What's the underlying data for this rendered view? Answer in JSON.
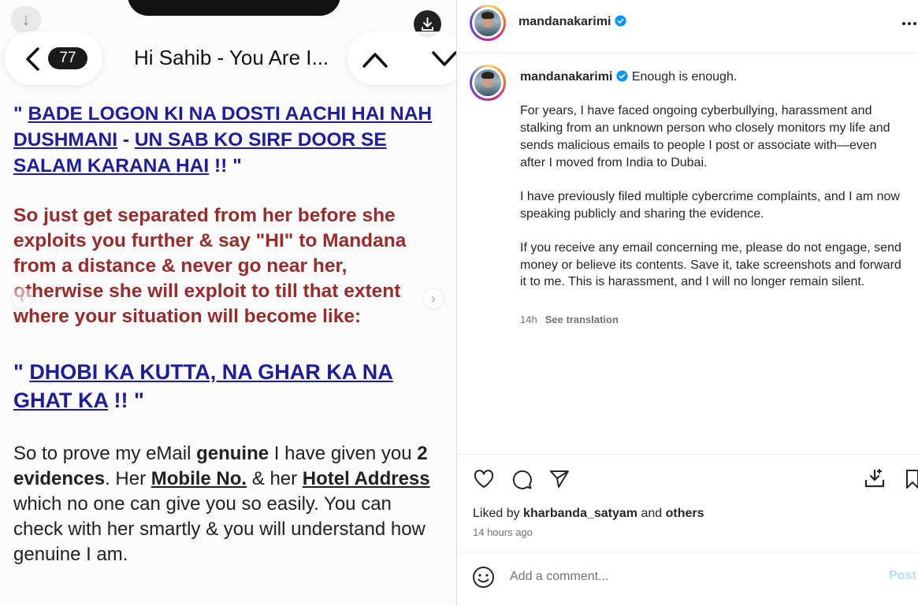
{
  "screenshot": {
    "count": "77",
    "subject": "Hi Sahib - You Are I...",
    "quote1": {
      "open": "\" ",
      "link1": "BADE LOGON KI NA DOSTI AACHI HAI NAH",
      "link2": "DUSHMANI",
      "sep": " - ",
      "link3": "UN SAB KO SIRF DOOR SE",
      "link4": "SALAM KARANA HAI",
      "close": " !! \""
    },
    "warning_lines": [
      "So just get separated from her before she",
      "exploits you further & say \"HI\" to Mandana",
      "from a distance & never go near her,",
      "otherwise she will exploit to till that extent",
      "where your situation will become like:"
    ],
    "quote2": {
      "open": "\" ",
      "link1": "DHOBI KA KUTTA, NA GHAR KA NA",
      "link2": "GHAT KA",
      "close": " !! \""
    },
    "proof": {
      "p1": "So to prove my eMail ",
      "b1": "genuine",
      "p2": " I have given you ",
      "b2": "2",
      "b3": "evidences",
      "p3": ". Her ",
      "u1": "Mobile No.",
      "p4": " & her ",
      "u2": "Hotel Address",
      "line3": "which no one can give you so easily. You can",
      "line4": "check with her smartly & you will understand how",
      "line5": "genuine I am."
    }
  },
  "post": {
    "username": "mandanakarimi",
    "caption_first": "Enough is enough.",
    "paragraphs": [
      "For years, I have faced ongoing cyberbullying, harassment and stalking from an unknown person who closely monitors my life and sends malicious emails to people I post or associate with—even after I moved from India to Dubai.",
      "I have previously filed multiple cybercrime complaints, and I am now speaking publicly and sharing the evidence.",
      "If you receive any email concerning me, please do not engage, send money or believe its contents. Save it, take screenshots and forward it to me. This is harassment, and I will no longer remain silent."
    ],
    "caption_age": "14h",
    "see_translation": "See translation",
    "liked_prefix": "Liked by ",
    "liked_user": "kharbanda_satyam",
    "liked_and": " and ",
    "liked_others": "others",
    "time_ago": "14 hours ago",
    "comment_placeholder": "Add a comment...",
    "post_label": "Post"
  },
  "icons": {
    "verified": "verified-badge-icon",
    "more": "more-options-icon",
    "like": "heart-icon",
    "comment": "comment-bubble-icon",
    "share": "paper-plane-icon",
    "save_collection": "save-to-collection-icon",
    "bookmark": "bookmark-icon",
    "emoji": "emoji-icon"
  },
  "colors": {
    "verified_blue": "#0095f6",
    "email_blue": "#1d1d9e",
    "email_red": "#9b2a2a",
    "post_button_disabled": "#b2dffc"
  }
}
